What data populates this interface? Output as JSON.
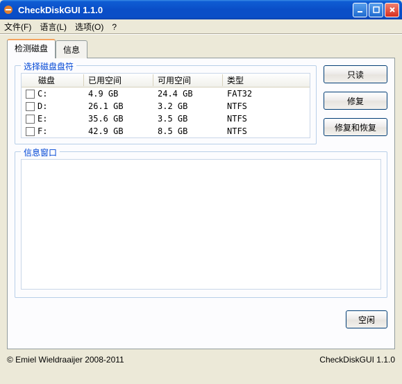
{
  "window": {
    "title": "CheckDiskGUI 1.1.0"
  },
  "menu": {
    "file": "文件(F)",
    "language": "语言(L)",
    "options": "选项(O)",
    "help": "?"
  },
  "tabs": {
    "detect": "检测磁盘",
    "info": "信息"
  },
  "disk_group": {
    "legend": "选择磁盘盘符",
    "headers": {
      "disk": "磁盘",
      "used": "已用空间",
      "free": "可用空间",
      "type": "类型"
    },
    "rows": [
      {
        "disk": "C:",
        "used": "4.9 GB",
        "free": "24.4 GB",
        "type": "FAT32"
      },
      {
        "disk": "D:",
        "used": "26.1 GB",
        "free": "3.2 GB",
        "type": "NTFS"
      },
      {
        "disk": "E:",
        "used": "35.6 GB",
        "free": "3.5 GB",
        "type": "NTFS"
      },
      {
        "disk": "F:",
        "used": "42.9 GB",
        "free": "8.5 GB",
        "type": "NTFS"
      }
    ]
  },
  "buttons": {
    "readonly": "只读",
    "fix": "修复",
    "fix_recover": "修复和恢复",
    "idle": "空闲"
  },
  "info_group": {
    "legend": "信息窗口"
  },
  "status": {
    "copyright": "© Emiel Wieldraaijer 2008-2011",
    "version": "CheckDiskGUI 1.1.0"
  }
}
